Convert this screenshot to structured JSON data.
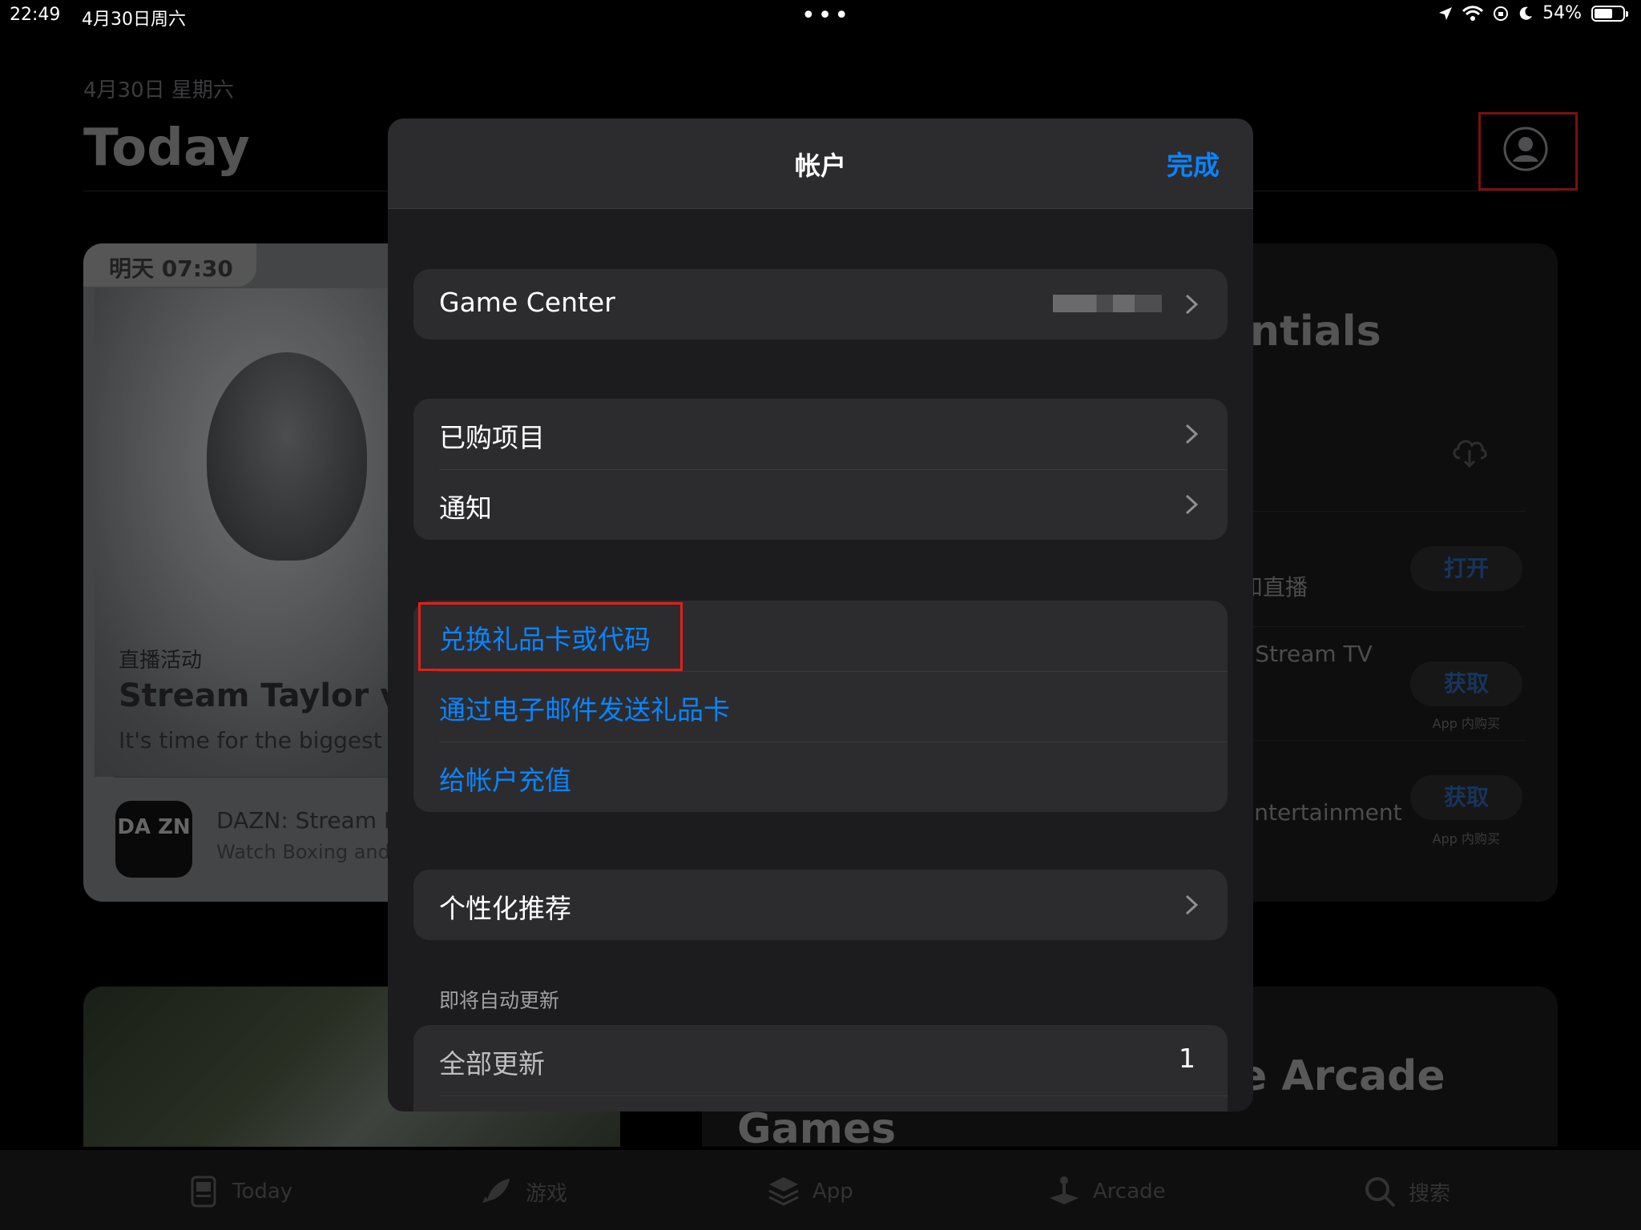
{
  "status_bar": {
    "time": "22:49",
    "date": "4月30日周六",
    "battery": "54%",
    "battery_level": 0.54
  },
  "background": {
    "date": "4月30日 星期六",
    "title": "Today",
    "featured_card": {
      "badge": "明天 07:30",
      "kicker": "直播活动",
      "headline": "Stream Taylor v S",
      "subtitle": "It's time for the biggest w",
      "app_logo": "DA ZN",
      "app_name": "DAZN: Stream I",
      "app_subtitle": "Watch Boxing and"
    },
    "list_card": {
      "heading": "ntials",
      "rows": [
        {
          "text": "和直播",
          "button": "打开",
          "iap": ""
        },
        {
          "text": ": Stream TV",
          "button": "获取",
          "iap": "App 内购买"
        },
        {
          "text": "entertainment",
          "button": "获取",
          "iap": "App 内购买"
        }
      ]
    },
    "bottom_card": {
      "title_line1": "e Arcade",
      "title_line2": "Games"
    }
  },
  "tab_bar": {
    "items": [
      {
        "label": "Today",
        "icon": "today-icon"
      },
      {
        "label": "游戏",
        "icon": "rocket-icon"
      },
      {
        "label": "App",
        "icon": "app-stack-icon"
      },
      {
        "label": "Arcade",
        "icon": "joystick-icon"
      },
      {
        "label": "搜索",
        "icon": "search-icon"
      }
    ]
  },
  "modal": {
    "title": "帐户",
    "done": "完成",
    "game_center": {
      "label": "Game Center"
    },
    "group_purchases": [
      {
        "label": "已购项目"
      },
      {
        "label": "通知"
      }
    ],
    "group_gifts": [
      {
        "label": "兑换礼品卡或代码"
      },
      {
        "label": "通过电子邮件发送礼品卡"
      },
      {
        "label": "给帐户充值"
      }
    ],
    "personalized": {
      "label": "个性化推荐"
    },
    "updates_caption": "即将自动更新",
    "update_all": {
      "label": "全部更新",
      "count": "1"
    }
  },
  "colors": {
    "accent": "#0a84ff",
    "highlight": "#e0201c",
    "modal_bg": "#1c1c1e",
    "group_bg": "#2c2c2e"
  }
}
